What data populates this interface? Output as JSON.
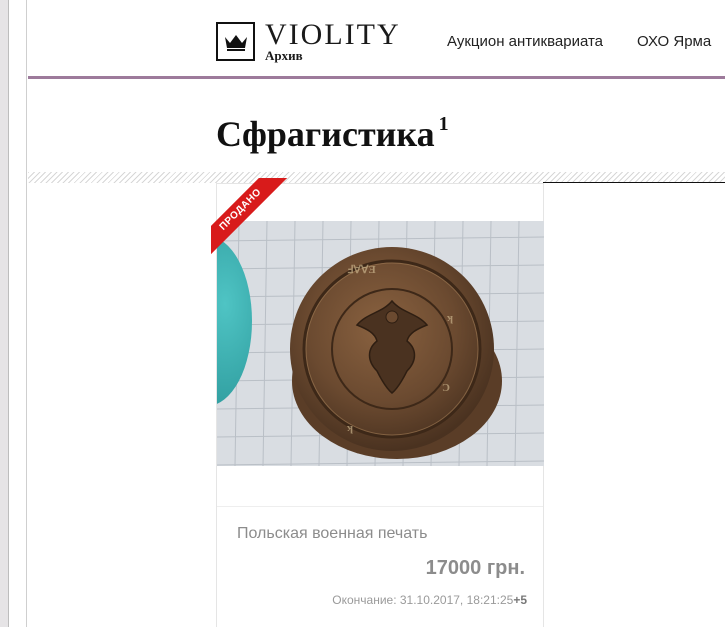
{
  "header": {
    "logo_title": "VIOLITY",
    "logo_subtitle": "Архив",
    "nav": [
      {
        "label": "Аукцион антиквариата"
      },
      {
        "label": "ОХО Ярма"
      }
    ],
    "accent_color": "#9d7a9b"
  },
  "page": {
    "title": "Сфрагистика",
    "count": "1"
  },
  "lot": {
    "badge": "ПРОДАНО",
    "badge_color": "#d81b1b",
    "name": "Польская военная печать",
    "price": "17000 грн.",
    "end_label": "Окончание: 31.10.2017, 18:21:25",
    "timezone": "+5",
    "image": "seal-photo-icon"
  }
}
